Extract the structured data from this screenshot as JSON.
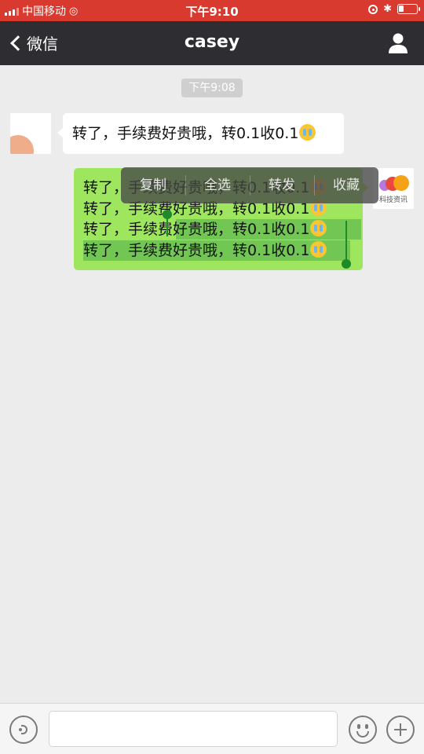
{
  "status_bar": {
    "carrier": "中国移动",
    "time": "下午9:10",
    "icons": [
      "signal-icon",
      "wifi-icon",
      "rotation-lock-icon",
      "bluetooth-icon",
      "battery-icon"
    ]
  },
  "nav": {
    "back_label": "微信",
    "title": "casey",
    "profile_icon": "person-icon"
  },
  "chat": {
    "timestamp": "下午9:08",
    "incoming": {
      "text": "转了，手续费好贵哦，转0.1收0.1",
      "emoji": "crying-face-emoji"
    },
    "outgoing": {
      "lines": [
        "转了，手续费好贵哦，转0.1收0.1",
        "转了，手续费好贵哦，转0.1收0.1",
        "转了，手续费好贵哦，转0.1收0.1",
        "转了，手续费好贵哦，转0.1收0.1"
      ],
      "emoji": "crying-face-emoji"
    },
    "avatar_right_caption": "科技资讯",
    "context_menu": [
      "复制",
      "全选",
      "转发",
      "收藏"
    ]
  },
  "input_bar": {
    "icons": [
      "voice-icon",
      "emoji-icon",
      "plus-icon"
    ],
    "value": ""
  },
  "colors": {
    "status_bar": "#d83a2f",
    "nav_bar": "#2e2e32",
    "chat_bg": "#ececec",
    "outgoing_bubble": "#9fe65f",
    "selection": "#3ca046"
  }
}
